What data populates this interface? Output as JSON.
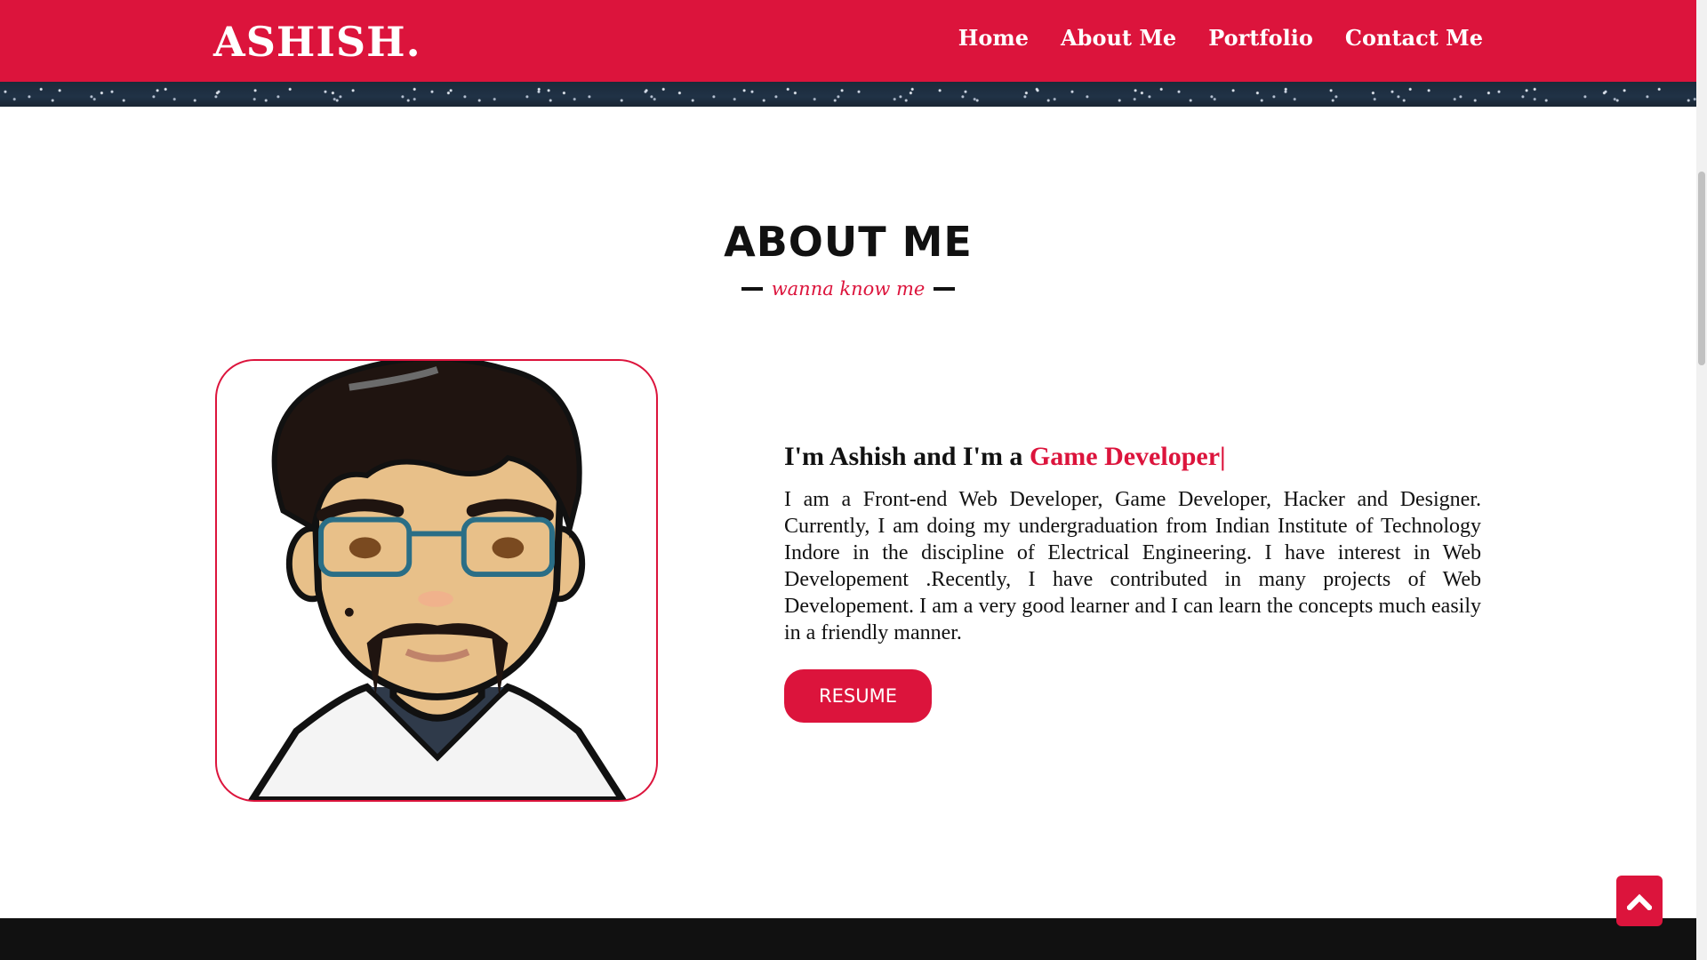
{
  "nav": {
    "logo": "ASHISH.",
    "links": [
      "Home",
      "About Me",
      "Portfolio",
      "Contact Me"
    ]
  },
  "about": {
    "title": "ABOUT ME",
    "subtitle": "wanna know me",
    "intro_prefix": "I'm Ashish and I'm a ",
    "intro_role": "Game Developer|",
    "body": "I am a Front-end Web Developer, Game Developer, Hacker and Designer. Currently, I am doing my undergraduation from Indian Institute of Technology Indore in the discipline of Electrical Engineering. I have interest in Web Developement .Recently, I have contributed in many projects of Web Developement. I am a very good learner and I can learn the concepts much easily in a friendly manner.",
    "resume_label": "RESUME"
  },
  "colors": {
    "accent": "#dc143c",
    "footer": "#111111"
  },
  "icons": {
    "back_to_top": "chevron-up-icon"
  }
}
